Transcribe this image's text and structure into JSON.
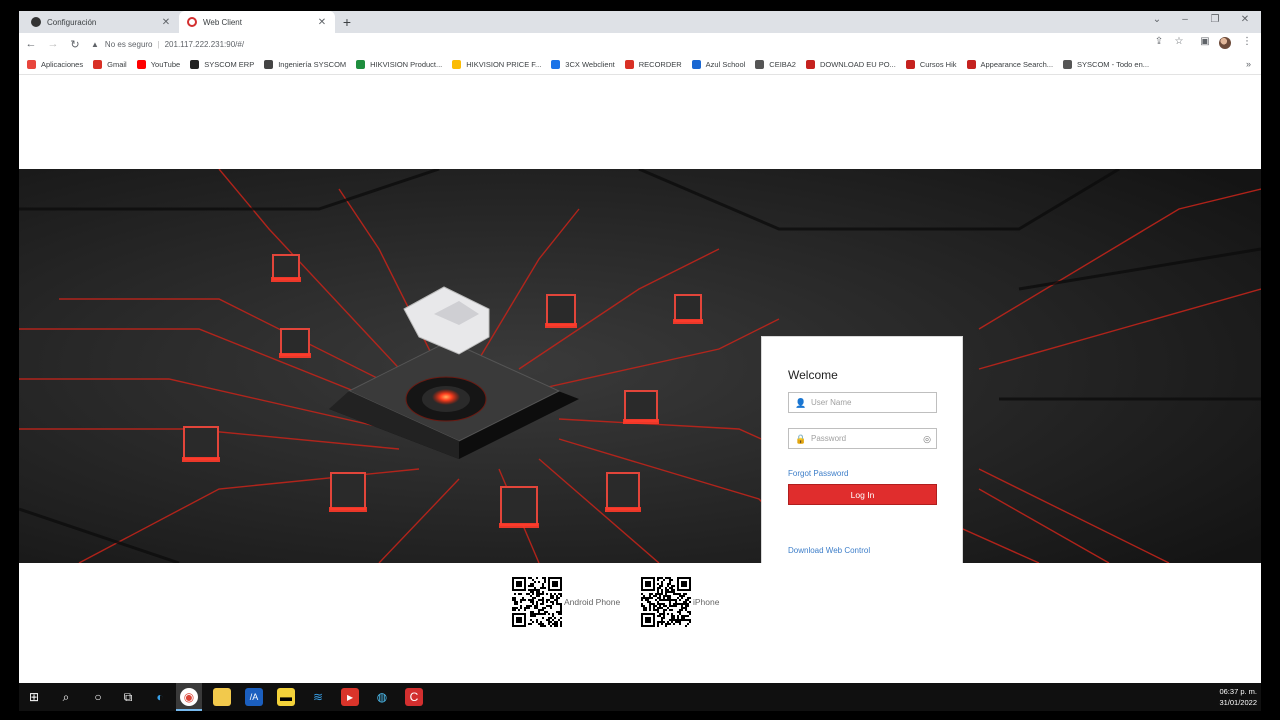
{
  "tabs": [
    {
      "title": "Configuración",
      "active": false
    },
    {
      "title": "Web Client",
      "active": true
    }
  ],
  "toolbar": {
    "security": "No es seguro",
    "url": "201.117.222.231:90/#/"
  },
  "bookmarks": [
    {
      "label": "Aplicaciones",
      "icon": "apps-grid-icon",
      "color": "#e8453c"
    },
    {
      "label": "Gmail",
      "icon": "gmail-icon",
      "color": "#d93025"
    },
    {
      "label": "YouTube",
      "icon": "youtube-icon",
      "color": "#ff0000"
    },
    {
      "label": "SYSCOM ERP",
      "icon": "syscom-icon",
      "color": "#222222"
    },
    {
      "label": "Ingeniería SYSCOM",
      "icon": "gear-icon",
      "color": "#444444"
    },
    {
      "label": "HIKVISION Product...",
      "icon": "hik-product-icon",
      "color": "#1e8e3e"
    },
    {
      "label": "HIKVISION PRICE F...",
      "icon": "drive-icon",
      "color": "#fbbc04"
    },
    {
      "label": "3CX Webclient",
      "icon": "3cx-icon",
      "color": "#1a73e8"
    },
    {
      "label": "RECORDER",
      "icon": "recorder-icon",
      "color": "#d93025"
    },
    {
      "label": "Azul School",
      "icon": "azul-icon",
      "color": "#1967d2"
    },
    {
      "label": "CEIBA2",
      "icon": "globe-icon",
      "color": "#555555"
    },
    {
      "label": "DOWNLOAD EU PO...",
      "icon": "hik-red-icon",
      "color": "#c5221f"
    },
    {
      "label": "Cursos Hik",
      "icon": "hik-red-icon",
      "color": "#c5221f"
    },
    {
      "label": "Appearance Search...",
      "icon": "hik-red-icon",
      "color": "#c5221f"
    },
    {
      "label": "SYSCOM - Todo en...",
      "icon": "globe-icon",
      "color": "#555555"
    }
  ],
  "login": {
    "welcome": "Welcome",
    "username_placeholder": "User Name",
    "password_placeholder": "Password",
    "forgot": "Forgot Password",
    "login_button": "Log In",
    "download": "Download Web Control"
  },
  "qr": {
    "android": "Android Phone",
    "iphone": "iPhone"
  },
  "clock": {
    "time": "06:37 p. m.",
    "date": "31/01/2022"
  },
  "colors": {
    "accent": "#e02d2d",
    "link": "#3d7ec9"
  }
}
